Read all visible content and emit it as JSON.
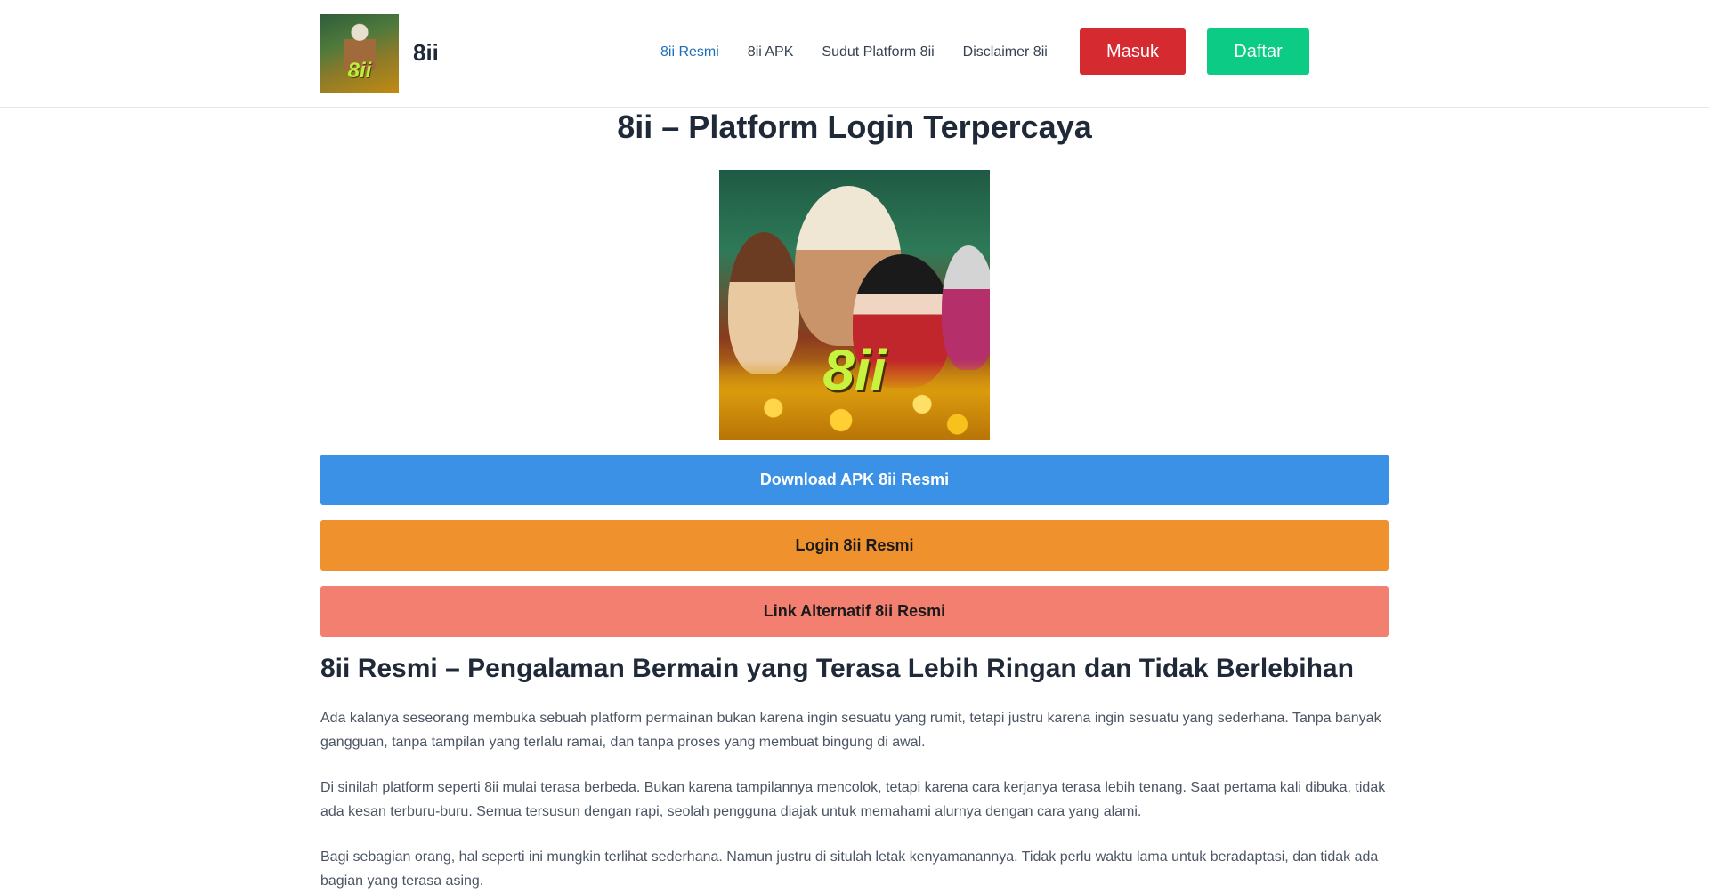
{
  "header": {
    "logo_text": "8ii",
    "brand": "8ii",
    "nav": [
      {
        "label": "8ii Resmi"
      },
      {
        "label": "8ii APK"
      },
      {
        "label": "Sudut Platform 8ii"
      },
      {
        "label": "Disclaimer 8ii"
      }
    ],
    "masuk_label": "Masuk",
    "daftar_label": "Daftar"
  },
  "main": {
    "title": "8ii – Platform Login Terpercaya",
    "hero_text": "8ii",
    "buttons": {
      "download": "Download APK 8ii Resmi",
      "login": "Login 8ii Resmi",
      "link": "Link Alternatif 8ii Resmi"
    },
    "article": {
      "heading": "8ii Resmi – Pengalaman Bermain yang Terasa Lebih Ringan dan Tidak Berlebihan",
      "paragraphs": [
        "Ada kalanya seseorang membuka sebuah platform permainan bukan karena ingin sesuatu yang rumit, tetapi justru karena ingin sesuatu yang sederhana. Tanpa banyak gangguan, tanpa tampilan yang terlalu ramai, dan tanpa proses yang membuat bingung di awal.",
        "Di sinilah platform seperti 8ii mulai terasa berbeda. Bukan karena tampilannya mencolok, tetapi karena cara kerjanya terasa lebih tenang. Saat pertama kali dibuka, tidak ada kesan terburu-buru. Semua tersusun dengan rapi, seolah pengguna diajak untuk memahami alurnya dengan cara yang alami.",
        "Bagi sebagian orang, hal seperti ini mungkin terlihat sederhana. Namun justru di situlah letak kenyamanannya. Tidak perlu waktu lama untuk beradaptasi, dan tidak ada bagian yang terasa asing."
      ]
    }
  },
  "colors": {
    "masuk": "#d62a31",
    "daftar": "#0ccb84",
    "download": "#3b91e6",
    "login": "#ef922e",
    "link": "#f37f71",
    "nav_active": "#1d6fb8"
  }
}
